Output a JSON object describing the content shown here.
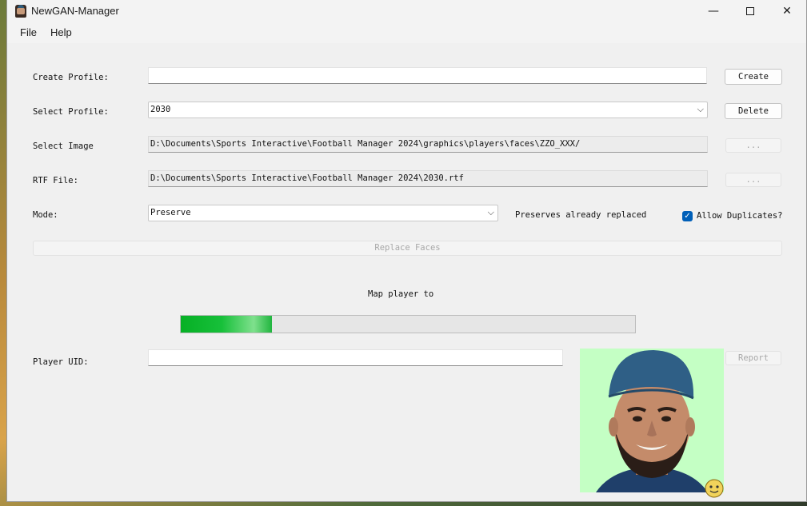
{
  "app": {
    "title": "NewGAN-Manager"
  },
  "window_controls": {
    "minimize": "—",
    "close": "✕"
  },
  "menu": {
    "file": "File",
    "help": "Help"
  },
  "form": {
    "create_profile_label": "Create Profile:",
    "create_profile_value": "",
    "create_button": "Create",
    "select_profile_label": "Select Profile:",
    "select_profile_value": "2030",
    "delete_button": "Delete",
    "select_image_label": "Select Image",
    "select_image_path": "D:\\Documents\\Sports Interactive\\Football Manager 2024\\graphics\\players\\faces\\ZZO_XXX/",
    "browse_image_button": "...",
    "rtf_file_label": "RTF File:",
    "rtf_file_path": "D:\\Documents\\Sports Interactive\\Football Manager 2024\\2030.rtf",
    "browse_rtf_button": "...",
    "mode_label": "Mode:",
    "mode_value": "Preserve",
    "mode_description": "Preserves already replaced",
    "allow_duplicates_label": "Allow Duplicates?",
    "allow_duplicates_checked": true,
    "replace_faces_button": "Replace Faces"
  },
  "mapping": {
    "status_text": "Map player to",
    "progress_fraction": 0.2
  },
  "player": {
    "uid_label": "Player UID:",
    "uid_value": "",
    "report_button": "Report"
  },
  "colors": {
    "progress_green": "#06b025",
    "checkbox_blue": "#005fb8",
    "photo_background": "#c4ffc4"
  },
  "icons": {
    "app_icon": "player-face-icon",
    "dropdown": "chevron-down-icon",
    "checkbox": "check-icon"
  }
}
